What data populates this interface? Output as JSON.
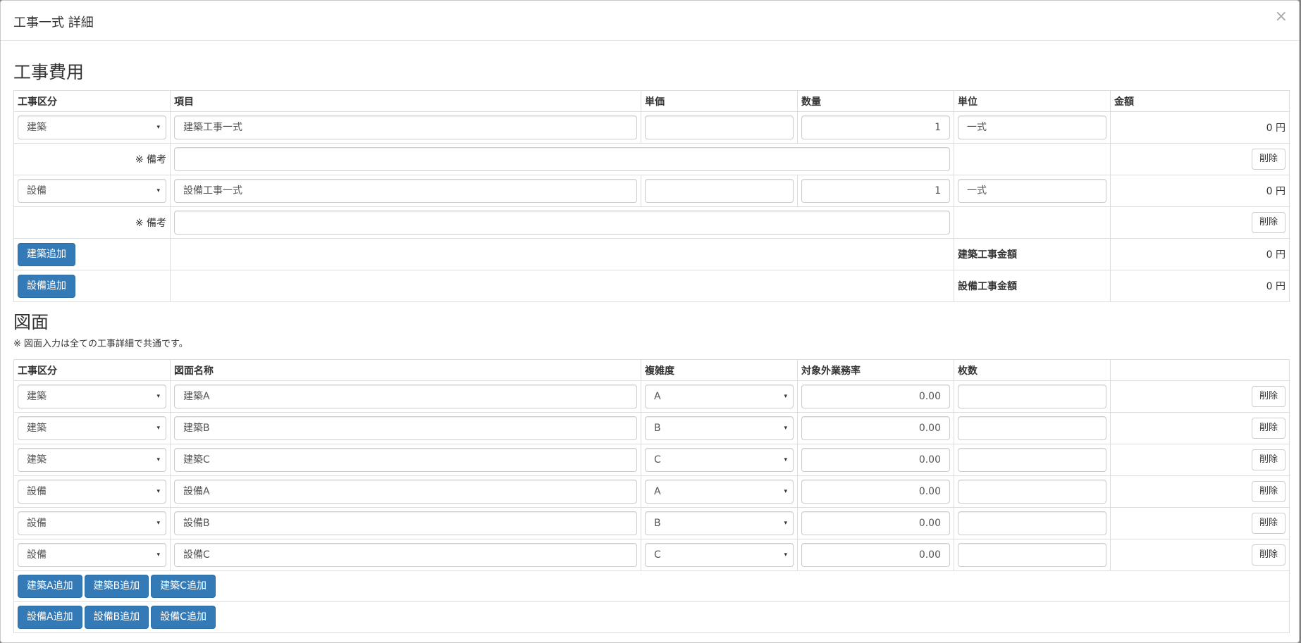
{
  "modal": {
    "title": "工事一式 詳細",
    "close": "×"
  },
  "cost": {
    "title": "工事費用",
    "headers": [
      "工事区分",
      "項目",
      "単価",
      "数量",
      "単位",
      "金額"
    ],
    "items": [
      {
        "category": "建築",
        "item": "建築工事一式",
        "unit_price": "",
        "quantity": "1",
        "unit": "一式",
        "amount": "0 円",
        "remark_label": "※ 備考",
        "remark": "",
        "delete": "削除"
      },
      {
        "category": "設備",
        "item": "設備工事一式",
        "unit_price": "",
        "quantity": "1",
        "unit": "一式",
        "amount": "0 円",
        "remark_label": "※ 備考",
        "remark": "",
        "delete": "削除"
      }
    ],
    "add_buttons": [
      "建築追加",
      "設備追加"
    ],
    "totals": [
      {
        "label": "建築工事金額",
        "amount": "0 円"
      },
      {
        "label": "設備工事金額",
        "amount": "0 円"
      }
    ]
  },
  "drawings": {
    "title": "図面",
    "note": "※ 図面入力は全ての工事詳細で共通です。",
    "headers": [
      "工事区分",
      "図面名称",
      "複雑度",
      "対象外業務率",
      "枚数",
      ""
    ],
    "rows": [
      {
        "category": "建築",
        "name": "建築A",
        "complexity": "A",
        "rate": "0.00",
        "sheets": "",
        "delete": "削除"
      },
      {
        "category": "建築",
        "name": "建築B",
        "complexity": "B",
        "rate": "0.00",
        "sheets": "",
        "delete": "削除"
      },
      {
        "category": "建築",
        "name": "建築C",
        "complexity": "C",
        "rate": "0.00",
        "sheets": "",
        "delete": "削除"
      },
      {
        "category": "設備",
        "name": "設備A",
        "complexity": "A",
        "rate": "0.00",
        "sheets": "",
        "delete": "削除"
      },
      {
        "category": "設備",
        "name": "設備B",
        "complexity": "B",
        "rate": "0.00",
        "sheets": "",
        "delete": "削除"
      },
      {
        "category": "設備",
        "name": "設備C",
        "complexity": "C",
        "rate": "0.00",
        "sheets": "",
        "delete": "削除"
      }
    ],
    "add_buttons_row1": [
      "建築A追加",
      "建築B追加",
      "建築C追加"
    ],
    "add_buttons_row2": [
      "設備A追加",
      "設備B追加",
      "設備C追加"
    ]
  },
  "colors": {
    "primary": "#337ab7",
    "border": "#dddddd"
  },
  "icons": {
    "select_caret": "▾"
  }
}
